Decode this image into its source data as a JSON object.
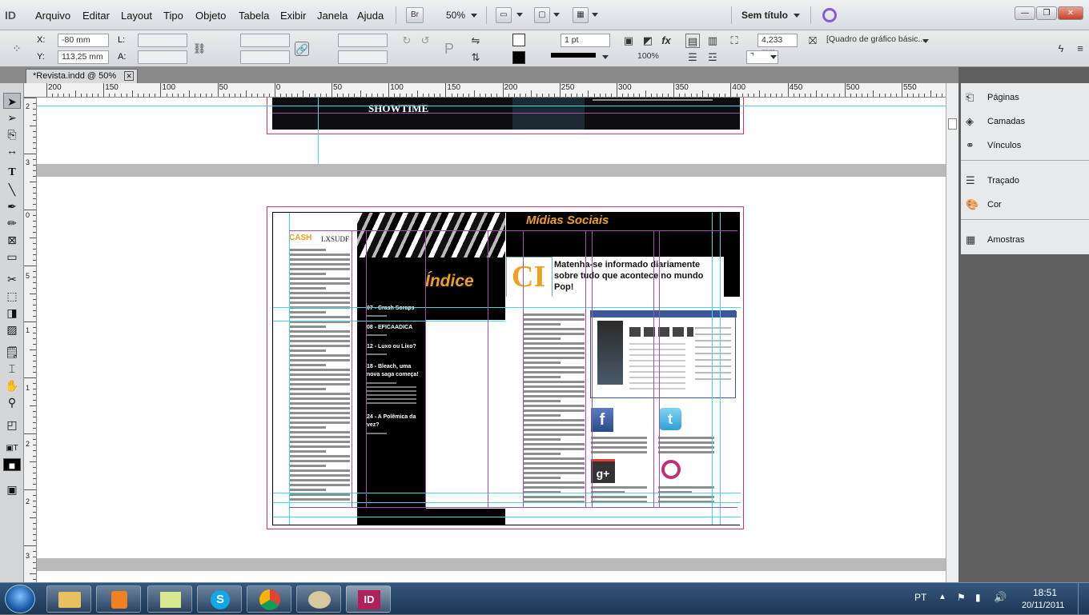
{
  "app": {
    "logo": "ID"
  },
  "menu": [
    "Arquivo",
    "Editar",
    "Layout",
    "Tipo",
    "Objeto",
    "Tabela",
    "Exibir",
    "Janela",
    "Ajuda"
  ],
  "appbar": {
    "bridge": "Br",
    "zoom": "50%",
    "workspace": "Sem título"
  },
  "control": {
    "x_label": "X:",
    "x_value": "-80 mm",
    "y_label": "Y:",
    "y_value": "113,25 mm",
    "l_label": "L:",
    "a_label": "A:",
    "stroke_weight": "1 pt",
    "opacity": "100%",
    "gutter": "4,233 mm",
    "object_style": "[Quadro de gráfico básic..."
  },
  "document_tab": {
    "title": "*Revista.indd @ 50%"
  },
  "ruler": {
    "h_labels": [
      "200",
      "150",
      "100",
      "50",
      "0",
      "50",
      "100",
      "150",
      "200",
      "250",
      "300",
      "350",
      "400",
      "450",
      "500",
      "550"
    ],
    "v_labels": [
      "2",
      "3",
      "0",
      "5",
      "1",
      "1",
      "2",
      "2",
      "3"
    ]
  },
  "spread": {
    "top_logo": "SHOWTIME",
    "left_brand": "CASH",
    "left_brand2": "LXSUDF",
    "indice_title": "Índice",
    "indice_items": [
      "07 - Crash Soraps",
      "08 - EFICAADICA",
      "12 - Luxo ou Lixo?",
      "18 - Bleach, uma nova saga começa!",
      "24 - A Polêmica da vez?"
    ],
    "midias_title": "Mídias Sociais",
    "midias_text": "Matenha-se informado diariamente sobre tudo que acontece no mundo Pop!",
    "logo_letters": "CI"
  },
  "panels": [
    {
      "label": "Páginas",
      "icon": "pages-icon"
    },
    {
      "label": "Camadas",
      "icon": "layers-icon"
    },
    {
      "label": "Vínculos",
      "icon": "links-icon"
    },
    {
      "label": "Traçado",
      "icon": "stroke-icon"
    },
    {
      "label": "Cor",
      "icon": "color-icon"
    },
    {
      "label": "Amostras",
      "icon": "swatches-icon"
    }
  ],
  "taskbar": {
    "lang": "PT",
    "time": "18:51",
    "date": "20/11/2011"
  },
  "colors": {
    "accent": "#f0a020",
    "guide_cyan": "#46d8e0",
    "guide_magenta": "#a44fb0",
    "bleed": "#e0306a"
  }
}
